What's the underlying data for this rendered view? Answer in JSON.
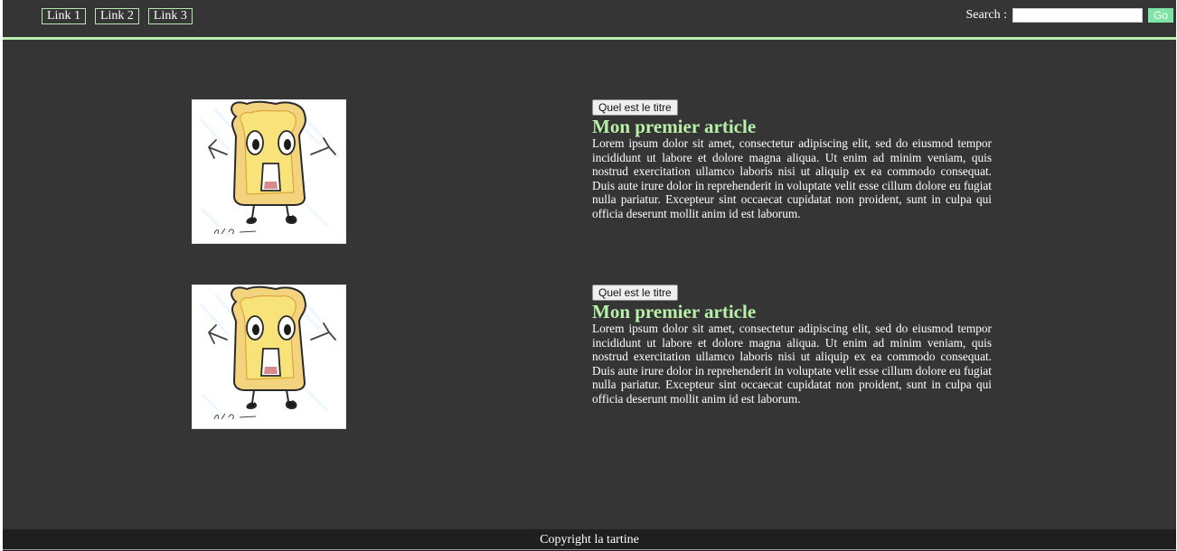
{
  "nav": {
    "links": [
      {
        "label": "Link 1"
      },
      {
        "label": "Link 2"
      },
      {
        "label": "Link 3"
      }
    ]
  },
  "search": {
    "label": "Search :",
    "value": "",
    "button_label": "Go"
  },
  "articles": [
    {
      "button_label": "Quel est le titre",
      "title": "Mon premier article",
      "text": "Lorem ipsum dolor sit amet, consectetur adipiscing elit, sed do eiusmod tempor incididunt ut labore et dolore magna aliqua. Ut enim ad minim veniam, quis nostrud exercitation ullamco laboris nisi ut aliquip ex ea commodo consequat. Duis aute irure dolor in reprehenderit in voluptate velit esse cillum dolore eu fugiat nulla pariatur. Excepteur sint occaecat cupidatat non proident, sunt in culpa qui officia deserunt mollit anim id est laborum.",
      "image_signature": "Clda Vanderhom"
    },
    {
      "button_label": "Quel est le titre",
      "title": "Mon premier article",
      "text": "Lorem ipsum dolor sit amet, consectetur adipiscing elit, sed do eiusmod tempor incididunt ut labore et dolore magna aliqua. Ut enim ad minim veniam, quis nostrud exercitation ullamco laboris nisi ut aliquip ex ea commodo consequat. Duis aute irure dolor in reprehenderit in voluptate velit esse cillum dolore eu fugiat nulla pariatur. Excepteur sint occaecat cupidatat non proident, sunt in culpa qui officia deserunt mollit anim id est laborum.",
      "image_signature": "Clda Vanderhom"
    }
  ],
  "footer": {
    "text": "Copyright la tartine"
  },
  "colors": {
    "page_background": "#353535",
    "accent_green": "#b8f0a8",
    "go_button": "#7fe3a3",
    "footer_background": "#1f1f1f"
  },
  "icons": {
    "article_image": "toast-character-illustration"
  }
}
